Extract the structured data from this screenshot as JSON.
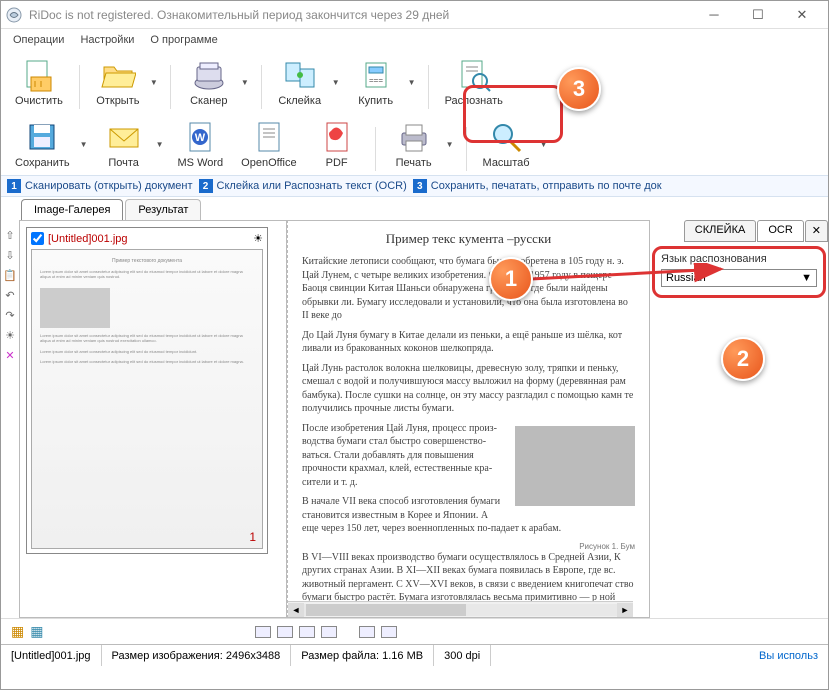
{
  "window": {
    "title": "RiDoc is not registered. Ознакомительный период закончится через 29 дней"
  },
  "menu": {
    "operations": "Операции",
    "settings": "Настройки",
    "about": "О программе"
  },
  "toolbar1": {
    "clear": "Очистить",
    "open": "Открыть",
    "scanner": "Сканер",
    "glue": "Склейка",
    "buy": "Купить",
    "recognize": "Распознать"
  },
  "toolbar2": {
    "save": "Сохранить",
    "mail": "Почта",
    "msword": "MS Word",
    "openoffice": "OpenOffice",
    "pdf": "PDF",
    "print": "Печать",
    "zoom": "Масштаб"
  },
  "steps": {
    "s1": "Сканировать (открыть) документ",
    "s2": "Склейка или Распознать текст (OCR)",
    "s3": "Сохранить, печатать, отправить по почте док"
  },
  "tabs": {
    "gallery": "Image-Галерея",
    "result": "Результат"
  },
  "thumb": {
    "name": "[Untitled]001.jpg",
    "page": "1"
  },
  "preview": {
    "title": "Пример текс               кумента –русски",
    "p1": "Китайские летописи сообщают, что бумага была изобретена в 105 году н. э. Цай Лунем, с четыре великих изобретения. Однако в 1957 году в пещере Баоця свинции Китая Шаньси обнаружена гробница, где были найдены обрывки ли. Бумагу исследовали и установили, что она была изготовлена во II веке до",
    "p2": "До Цай Луня бумагу в Китае делали из пеньки, а ещё раньше из шёлка, кот ливали из бракованных коконов шелкопряда.",
    "p3": "Цай Лунь растолок волокна шелковицы, древесную золу, тряпки и пеньку, смешал с водой и получившуюся массу выложил на форму (деревянная рам бамбука). После сушки на солнце, он эту массу разгладил с помощью камн те получились прочные листы бумаги.",
    "p4": "После изобретения Цай Луня, процесс произ-водства бумаги стал быстро совершенство-ваться. Стали добавлять для повышения прочности крахмал, клей, естественные кра-сители и т. д.",
    "p5": "В начале VII века способ изготовления бумаги становится известным в Корее и Японии. А еще через 150 лет, через военнопленных по-падает к арабам.",
    "p6": "В VI—VIII веках производство бумаги осуществлялось в Средней Азии, К других странах Азии. В XI—XII веках бумага появилась в Европе, где вс. животный пергамент. С XV—XVI веков, в связи с введением книгопечат ство бумаги быстро растёт. Бумага изготовлялась весьма примитивно — р ной массы деревянными молотками в ступе и вычерпкой её формами с се",
    "caption": "Рисунок 1. Бум"
  },
  "right": {
    "tab_glue": "СКЛЕЙКА",
    "tab_ocr": "OCR",
    "lang_label": "Язык распознования",
    "lang_value": "Russian"
  },
  "status": {
    "file": "[Untitled]001.jpg",
    "size": "Размер изображения: 2496x3488",
    "filesize": "Размер файла: 1.16 MB",
    "dpi": "300 dpi",
    "trial": "Вы использ"
  },
  "callouts": {
    "c1": "1",
    "c2": "2",
    "c3": "3"
  }
}
